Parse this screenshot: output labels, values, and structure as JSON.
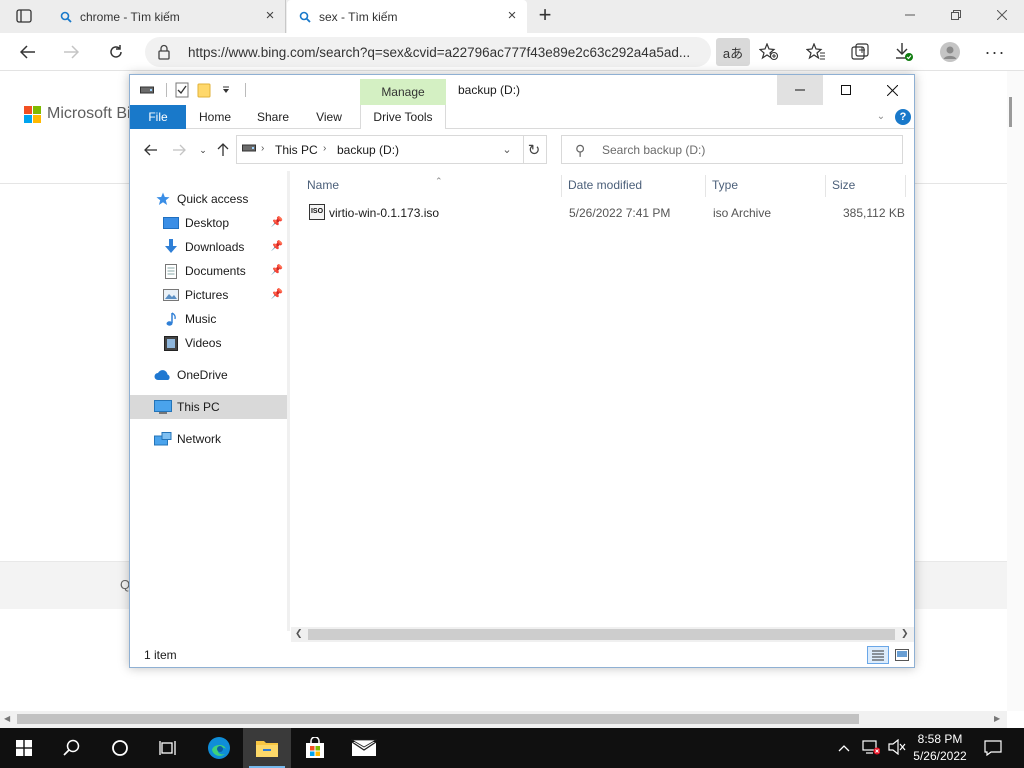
{
  "browser": {
    "tabs": [
      {
        "title": "chrome - Tìm kiếm"
      },
      {
        "title": "sex - Tìm kiếm"
      }
    ],
    "url": "https://www.bing.com/search?q=sex&cvid=a22796ac777f43e89e2c63c292a4a5ad...",
    "translate_label": "aあ",
    "page": {
      "logo_text": "Microsoft Bing",
      "band_char": "Q"
    }
  },
  "explorer": {
    "title": "backup (D:)",
    "contextual_tab": "Manage",
    "ribbon_tabs": {
      "file": "File",
      "home": "Home",
      "share": "Share",
      "view": "View",
      "drive_tools": "Drive Tools"
    },
    "breadcrumb": [
      "This PC",
      "backup (D:)"
    ],
    "search_placeholder": "Search backup (D:)",
    "sidebar": {
      "quick_access": "Quick access",
      "desktop": "Desktop",
      "downloads": "Downloads",
      "documents": "Documents",
      "pictures": "Pictures",
      "music": "Music",
      "videos": "Videos",
      "onedrive": "OneDrive",
      "this_pc": "This PC",
      "network": "Network"
    },
    "columns": {
      "name": "Name",
      "date": "Date modified",
      "type": "Type",
      "size": "Size"
    },
    "files": [
      {
        "name": "virtio-win-0.1.173.iso",
        "date": "5/26/2022 7:41 PM",
        "type": "iso Archive",
        "size": "385,112 KB",
        "icon_label": "ISO"
      }
    ],
    "status": "1 item"
  },
  "taskbar": {
    "time": "8:58 PM",
    "date": "5/26/2022"
  },
  "colors": {
    "accent": "#1979ca",
    "manage_tab": "#d4f0c3",
    "taskbar": "#101010"
  }
}
